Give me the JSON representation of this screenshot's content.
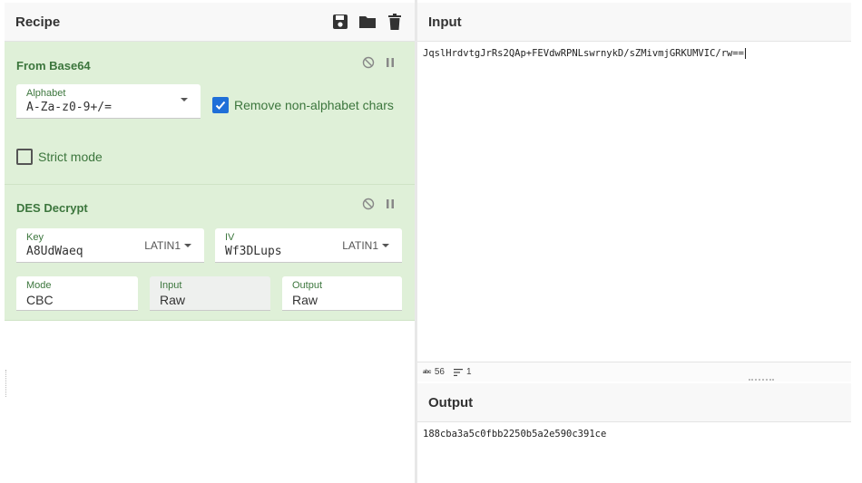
{
  "recipe": {
    "title": "Recipe",
    "operations": [
      {
        "name": "From Base64",
        "alphabet_label": "Alphabet",
        "alphabet_value": "A-Za-z0-9+/=",
        "remove_label": "Remove non-alphabet chars",
        "remove_checked": true,
        "strict_label": "Strict mode",
        "strict_checked": false
      },
      {
        "name": "DES Decrypt",
        "key_label": "Key",
        "key_value": "A8UdWaeq",
        "key_encoding": "LATIN1",
        "iv_label": "IV",
        "iv_value": "Wf3DLups",
        "iv_encoding": "LATIN1",
        "mode_label": "Mode",
        "mode_value": "CBC",
        "input_label": "Input",
        "input_value": "Raw",
        "output_label": "Output",
        "output_value": "Raw"
      }
    ]
  },
  "input": {
    "title": "Input",
    "text": "JqslHrdvtgJrRs2QAp+FEVdwRPNLswrnykD/sZMivmjGRKUMVIC/rw==",
    "char_count": "56",
    "line_count": "1"
  },
  "output": {
    "title": "Output",
    "text": "188cba3a5c0fbb2250b5a2e590c391ce"
  },
  "icons": {
    "save": "save-icon",
    "open": "folder-icon",
    "delete": "trash-icon",
    "disable": "disable-icon",
    "pause": "pause-icon"
  },
  "colors": {
    "op_bg": "#dff0d8",
    "op_text": "#3c763d",
    "checkbox": "#1f6fd8"
  }
}
